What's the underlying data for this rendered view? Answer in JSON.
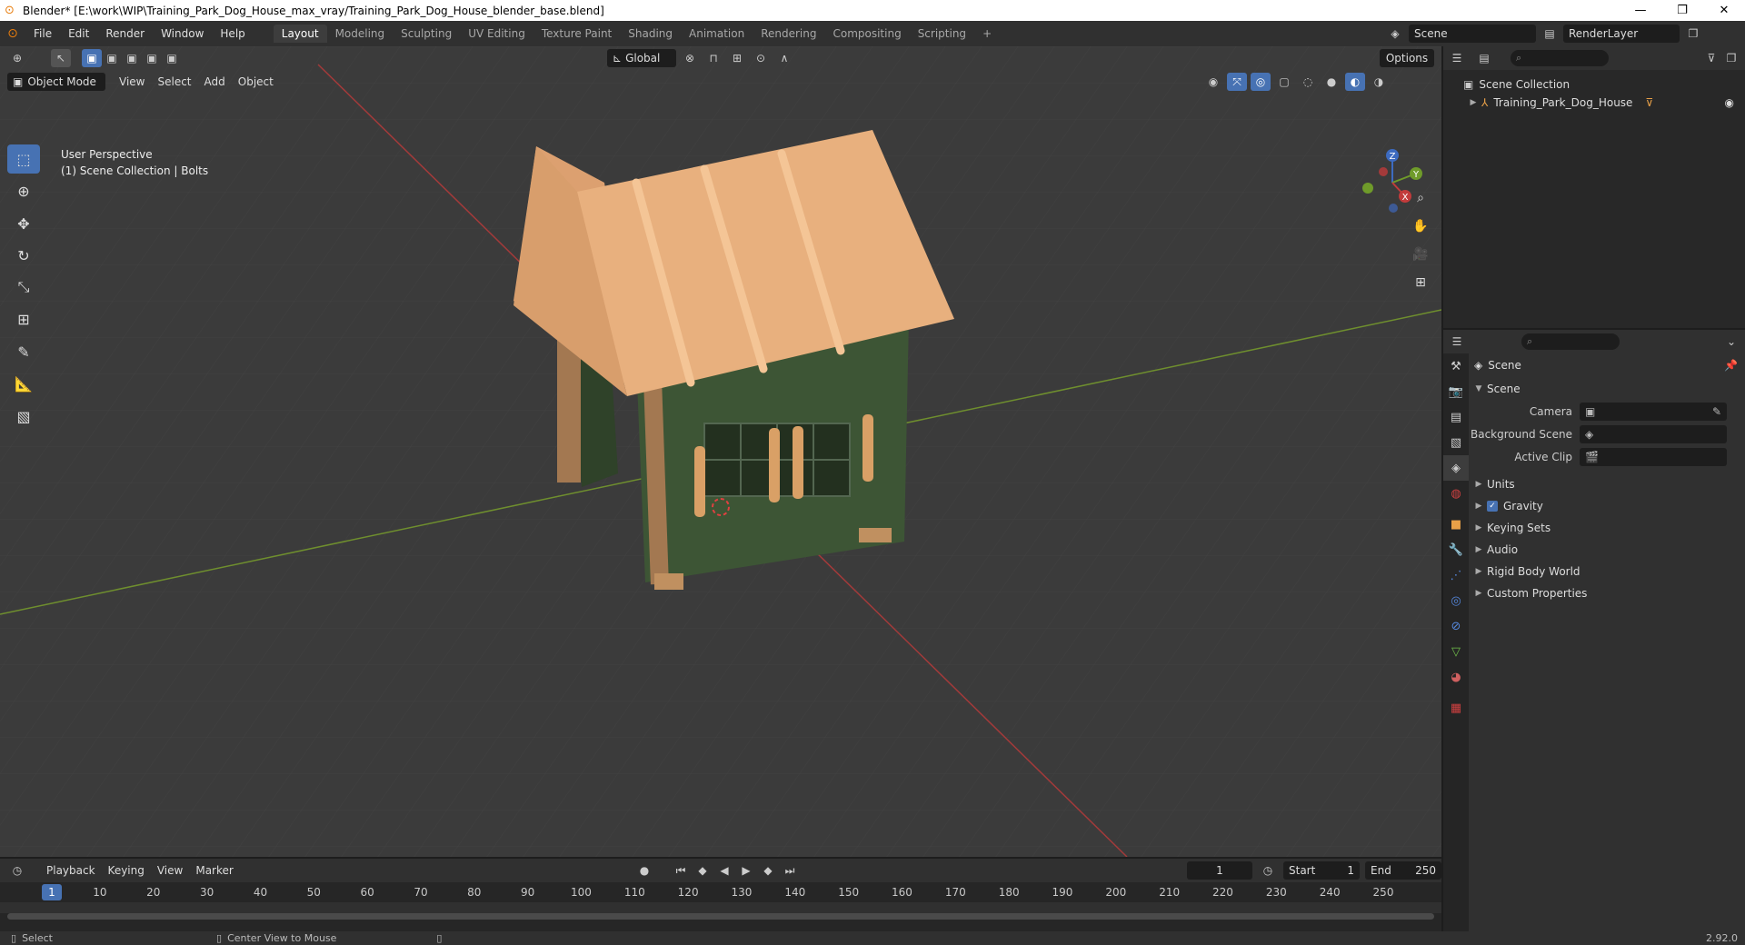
{
  "window": {
    "title": "Blender* [E:\\work\\WIP\\Training_Park_Dog_House_max_vray/Training_Park_Dog_House_blender_base.blend]",
    "minimize": "—",
    "maximize": "❐",
    "close": "✕"
  },
  "topbar": {
    "menus": [
      "File",
      "Edit",
      "Render",
      "Window",
      "Help"
    ],
    "workspaces": [
      "Layout",
      "Modeling",
      "Sculpting",
      "UV Editing",
      "Texture Paint",
      "Shading",
      "Animation",
      "Rendering",
      "Compositing",
      "Scripting"
    ],
    "active_workspace": "Layout",
    "add_tab": "+",
    "scene": "Scene",
    "view_layer": "RenderLayer"
  },
  "viewport": {
    "mode": "Object Mode",
    "menus": [
      "View",
      "Select",
      "Add",
      "Object"
    ],
    "orientation": "Global",
    "options": "Options",
    "info_line1": "User Perspective",
    "info_line2": "(1) Scene Collection | Bolts",
    "gizmo_axes": [
      "X",
      "Y",
      "Z"
    ]
  },
  "toolbar": {
    "tools": [
      "select-box-tool",
      "cursor-tool",
      "move-tool",
      "rotate-tool",
      "scale-tool",
      "transform-tool",
      "annotate-tool",
      "measure-tool",
      "add-cube-tool"
    ]
  },
  "outliner": {
    "root": "Scene Collection",
    "items": [
      {
        "label": "Training_Park_Dog_House"
      }
    ]
  },
  "properties": {
    "header": "Scene",
    "section": "Scene",
    "fields": [
      {
        "label": "Camera",
        "value": ""
      },
      {
        "label": "Background Scene",
        "value": ""
      },
      {
        "label": "Active Clip",
        "value": ""
      }
    ],
    "panels": [
      "Units",
      "Gravity",
      "Keying Sets",
      "Audio",
      "Rigid Body World",
      "Custom Properties"
    ],
    "gravity_checked": true
  },
  "timeline": {
    "menus": [
      "Playback",
      "Keying",
      "View",
      "Marker"
    ],
    "current_frame": "1",
    "start_label": "Start",
    "start": "1",
    "end_label": "End",
    "end": "250",
    "ticks": [
      "1",
      "10",
      "20",
      "30",
      "40",
      "50",
      "60",
      "70",
      "80",
      "90",
      "100",
      "110",
      "120",
      "130",
      "140",
      "150",
      "160",
      "170",
      "180",
      "190",
      "200",
      "210",
      "220",
      "230",
      "240",
      "250"
    ]
  },
  "statusbar": {
    "left": "Select",
    "middle": "Center View to Mouse",
    "version": "2.92.0"
  },
  "colors": {
    "accent": "#4772b3",
    "roof": "#e8b07e",
    "wall": "#3d5535",
    "wood": "#a37851",
    "x_axis": "#c23b3b",
    "y_axis": "#6f9b2a"
  }
}
